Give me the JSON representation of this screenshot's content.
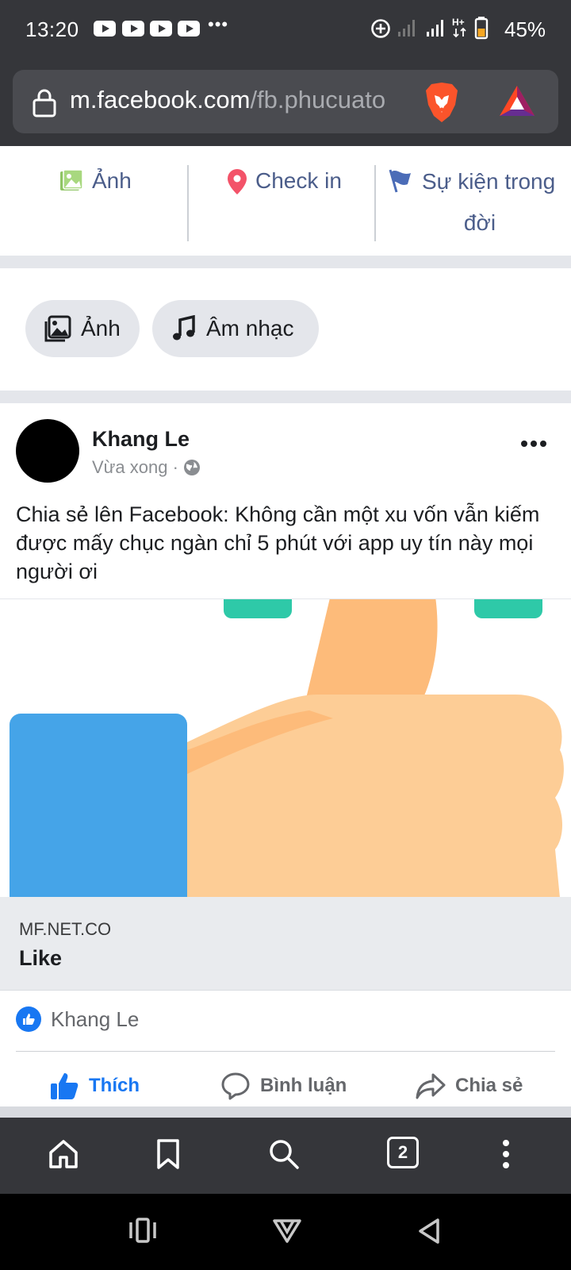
{
  "status_bar": {
    "time": "13:20",
    "overflow": "•••",
    "battery": "45%",
    "icons": [
      "youtube-icon",
      "youtube-icon",
      "youtube-icon",
      "youtube-icon",
      "data-saver-icon",
      "signal-icon",
      "signal-icon",
      "hplus-icon",
      "battery-icon"
    ]
  },
  "browser": {
    "url_host": "m.facebook.com",
    "url_path": "/fb.phucuato",
    "icons": [
      "lock-icon",
      "brave-lion-icon",
      "bat-token-icon"
    ]
  },
  "composer_actions": [
    {
      "label": "Ảnh",
      "icon": "photo-icon",
      "color": "#8fc564"
    },
    {
      "label": "Check in",
      "icon": "location-pin-icon",
      "color": "#f35369"
    },
    {
      "label": "Sự kiện trong",
      "label2": "đời",
      "icon": "flag-icon",
      "color": "#4b6cb7"
    }
  ],
  "chips": [
    {
      "label": "Ảnh",
      "icon": "photos-icon"
    },
    {
      "label": "Âm nhạc",
      "icon": "music-note-icon"
    }
  ],
  "post": {
    "author": "Khang Le",
    "time": "Vừa xong ·",
    "text": "Chia sẻ lên Facebook: Không cần một xu vốn vẫn kiếm được mấy chục ngàn chỉ 5 phút với app uy tín này mọi người ơi",
    "link_domain": "MF.NET.CO",
    "link_title": "Like",
    "reaction_name": "Khang Le"
  },
  "post_actions": [
    {
      "label": "Thích",
      "icon": "thumbs-up-icon",
      "active": true
    },
    {
      "label": "Bình luận",
      "icon": "comment-icon",
      "active": false
    },
    {
      "label": "Chia sẻ",
      "icon": "share-icon",
      "active": false
    }
  ],
  "browser_nav": {
    "tab_count": "2",
    "icons": [
      "home-icon",
      "bookmark-icon",
      "search-icon",
      "tabs-icon",
      "menu-icon"
    ]
  },
  "system_nav": {
    "icons": [
      "recents-icon",
      "home-logo-icon",
      "back-icon"
    ]
  },
  "colors": {
    "facebook_blue": "#1877f2",
    "toolbar_dark": "#35363a",
    "divider_gray": "#e4e6eb"
  }
}
